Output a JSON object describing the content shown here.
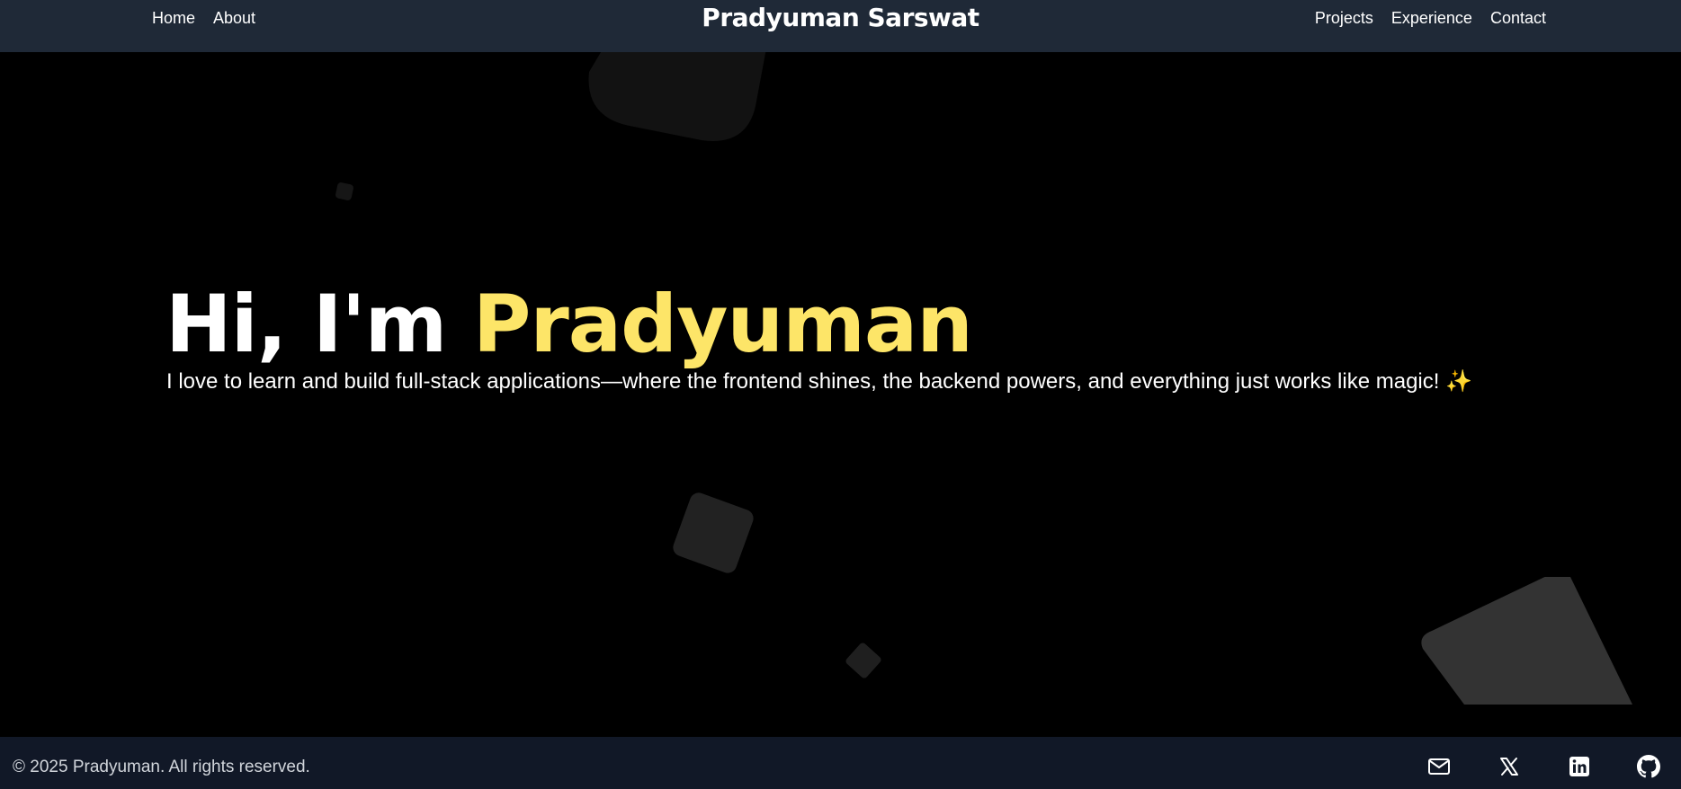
{
  "nav": {
    "left": [
      {
        "label": "Home"
      },
      {
        "label": "About"
      }
    ],
    "brand": "Pradyuman Sarswat",
    "right": [
      {
        "label": "Projects"
      },
      {
        "label": "Experience"
      },
      {
        "label": "Contact"
      }
    ]
  },
  "hero": {
    "greeting": "Hi, I'm ",
    "name": "Pradyuman",
    "subtitle": "I love to learn and build full-stack applications—where the frontend shines, the backend powers, and everything just works like magic! ✨"
  },
  "footer": {
    "copyright": "© 2025 Pradyuman. All rights reserved.",
    "social": [
      {
        "icon": "mail-icon"
      },
      {
        "icon": "x-icon"
      },
      {
        "icon": "linkedin-icon"
      },
      {
        "icon": "github-icon"
      }
    ]
  },
  "colors": {
    "header_bg": "#1f2937",
    "hero_bg": "#000000",
    "accent": "#fde568",
    "footer_bg": "#111827",
    "text": "#ffffff"
  }
}
